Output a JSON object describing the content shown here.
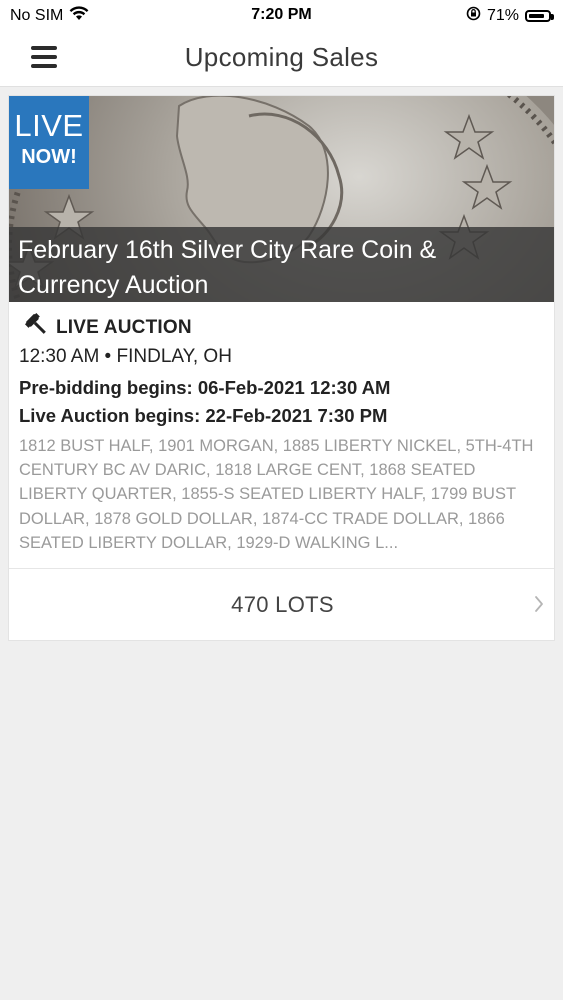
{
  "status_bar": {
    "carrier": "No SIM",
    "time": "7:20 PM",
    "battery": "71%",
    "icons": [
      "wifi-icon",
      "orientation-lock-icon",
      "battery-icon"
    ]
  },
  "nav": {
    "title": "Upcoming Sales",
    "menu_icon": "hamburger-menu-icon"
  },
  "sale": {
    "badge_line1": "LIVE",
    "badge_line2": "NOW!",
    "title": "February 16th Silver City Rare Coin & Currency Auction",
    "type_icon": "gavel-icon",
    "type": "LIVE AUCTION",
    "time_location": "12:30 AM • FINDLAY, OH",
    "pre_bidding": "Pre-bidding begins: 06-Feb-2021 12:30 AM",
    "live_begins": "Live Auction begins: 22-Feb-2021 7:30 PM",
    "description": "1812 BUST HALF, 1901 MORGAN, 1885 LIBERTY NICKEL, 5TH-4TH CENTURY BC AV DARIC, 1818 LARGE CENT, 1868 SEATED LIBERTY QUARTER, 1855-S SEATED LIBERTY HALF, 1799 BUST DOLLAR, 1878 GOLD DOLLAR, 1874-CC TRADE DOLLAR, 1866 SEATED LIBERTY DOLLAR, 1929-D WALKING L...",
    "lots": "470 LOTS"
  },
  "colors": {
    "badge_blue": "#2a77bd",
    "background": "#efefef",
    "description_gray": "#9a9a9a"
  }
}
